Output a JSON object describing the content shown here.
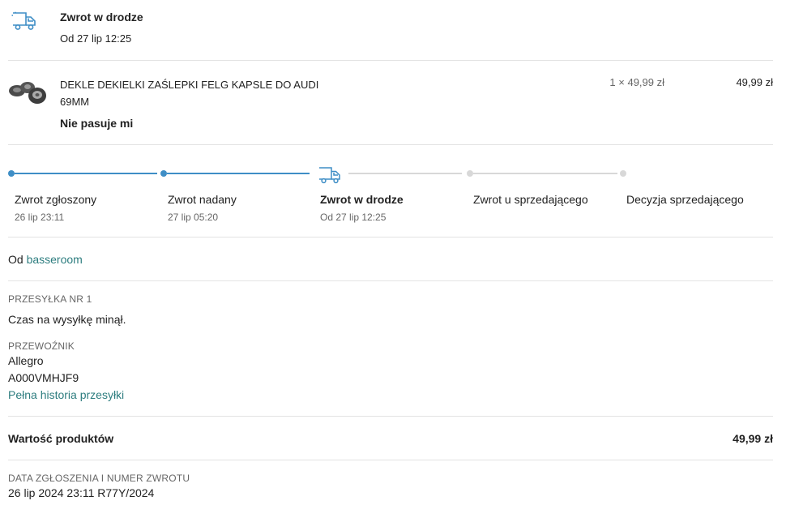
{
  "header": {
    "status_title": "Zwrot w drodze",
    "status_date": "Od 27 lip 12:25",
    "icon": "truck-icon"
  },
  "product": {
    "name": "DEKLE DEKIELKI ZAŚLEPKI FELG KAPSLE DO AUDI 69MM",
    "reason": "Nie pasuje mi",
    "quantity_price": "1 × 49,99 zł",
    "total": "49,99 zł"
  },
  "progress": {
    "accent_color": "#3f8ec6",
    "steps": [
      {
        "label": "Zwrot zgłoszony",
        "date": "26 lip 23:11",
        "state": "done"
      },
      {
        "label": "Zwrot nadany",
        "date": "27 lip 05:20",
        "state": "done"
      },
      {
        "label": "Zwrot w drodze",
        "date": "Od 27 lip 12:25",
        "state": "current"
      },
      {
        "label": "Zwrot u sprzedającego",
        "date": "",
        "state": "todo"
      },
      {
        "label": "Decyzja sprzedającego",
        "date": "",
        "state": "todo"
      }
    ]
  },
  "seller": {
    "prefix": "Od",
    "name": "basseroom"
  },
  "shipment": {
    "label": "PRZESYŁKA NR 1",
    "status": "Czas na wysyłkę minął.",
    "carrier_label": "PRZEWOŹNIK",
    "carrier_name": "Allegro",
    "tracking_number": "A000VMHJF9",
    "history_link": "Pełna historia przesyłki"
  },
  "summary": {
    "products_value_label": "Wartość produktów",
    "products_value": "49,99 zł"
  },
  "request": {
    "label": "DATA ZGŁOSZENIA I NUMER ZWROTU",
    "value": "26 lip 2024 23:11 R77Y/2024"
  }
}
